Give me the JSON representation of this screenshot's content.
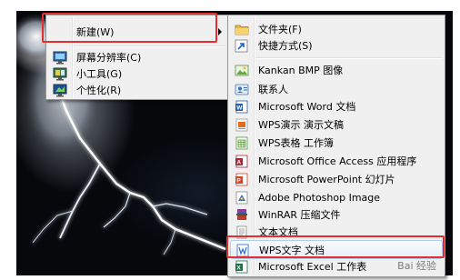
{
  "context_menu": {
    "items": [
      {
        "label": "新建(W)",
        "icon": "new-icon",
        "submenu": true,
        "highlighted": true
      },
      {
        "label": "屏幕分辨率(C)",
        "icon": "display-resolution-icon"
      },
      {
        "label": "小工具(G)",
        "icon": "gadgets-icon"
      },
      {
        "label": "个性化(R)",
        "icon": "personalize-icon"
      }
    ]
  },
  "new_submenu": {
    "items": [
      {
        "label": "文件夹(F)",
        "icon": "folder-icon"
      },
      {
        "label": "快捷方式(S)",
        "icon": "shortcut-icon"
      },
      {
        "label": "Kankan BMP 图像",
        "icon": "bmp-image-icon"
      },
      {
        "label": "联系人",
        "icon": "contact-icon"
      },
      {
        "label": "Microsoft Word 文档",
        "icon": "word-document-icon"
      },
      {
        "label": "WPS演示 演示文稿",
        "icon": "wps-presentation-icon"
      },
      {
        "label": "WPS表格 工作簿",
        "icon": "wps-spreadsheet-icon"
      },
      {
        "label": "Microsoft Office Access 应用程序",
        "icon": "access-database-icon"
      },
      {
        "label": "Microsoft PowerPoint 幻灯片",
        "icon": "powerpoint-icon"
      },
      {
        "label": "Adobe Photoshop Image",
        "icon": "photoshop-image-icon"
      },
      {
        "label": "WinRAR 压缩文件",
        "icon": "winrar-archive-icon"
      },
      {
        "label": "文本文档",
        "icon": "text-document-icon"
      },
      {
        "label": "WPS文字 文档",
        "icon": "wps-writer-document-icon",
        "highlighted": true
      },
      {
        "label": "Microsoft Excel 工作表",
        "icon": "excel-worksheet-icon"
      }
    ]
  },
  "watermark": "Bai 经验",
  "colors": {
    "highlight_border": "#e62e2e",
    "menu_bg": "#f0f0f0",
    "hover_border": "#aeccf0"
  }
}
